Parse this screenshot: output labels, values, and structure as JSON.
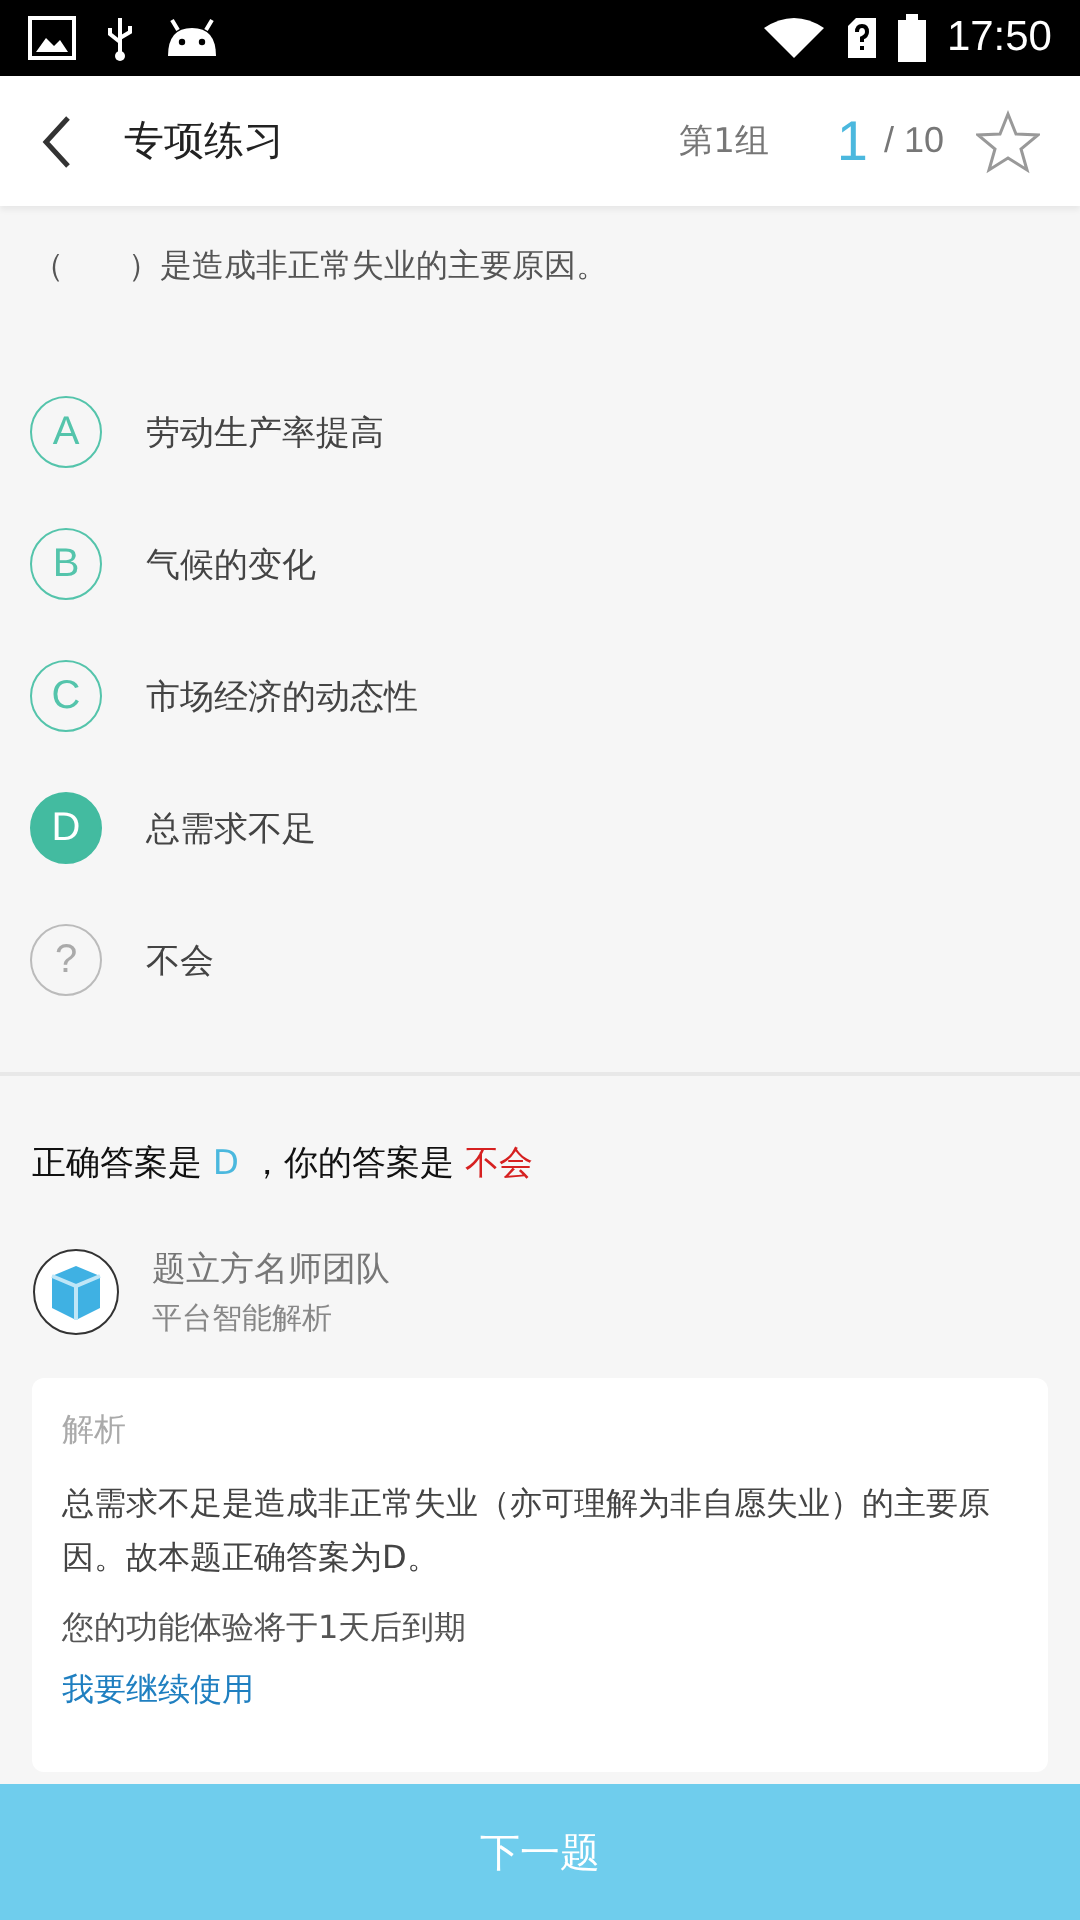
{
  "status_bar": {
    "time": "17:50"
  },
  "header": {
    "title": "专项练习",
    "group": "第1组",
    "current": "1",
    "total": "/ 10",
    "starred": false
  },
  "question": {
    "text": "（　　）是造成非正常失业的主要原因。"
  },
  "options": [
    {
      "kind": "letter",
      "marker": "A",
      "text": "劳动生产率提高",
      "selected": false
    },
    {
      "kind": "letter",
      "marker": "B",
      "text": "气候的变化",
      "selected": false
    },
    {
      "kind": "letter",
      "marker": "C",
      "text": "市场经济的动态性",
      "selected": false
    },
    {
      "kind": "letter",
      "marker": "D",
      "text": "总需求不足",
      "selected": true
    },
    {
      "kind": "unknown",
      "marker": "?",
      "text": "不会",
      "selected": false
    }
  ],
  "result": {
    "correct_label": "正确答案是",
    "correct": "D",
    "sep": "，你的答案是",
    "yours": "不会"
  },
  "analyst": {
    "name": "题立方名师团队",
    "subtitle": "平台智能解析"
  },
  "analysis": {
    "heading": "解析",
    "text": "总需求不足是造成非正常失业（亦可理解为非自愿失业）的主要原因。故本题正确答案为D。",
    "notice": "您的功能体验将于1天后到期",
    "link": "我要继续使用"
  },
  "next_button": "下一题"
}
